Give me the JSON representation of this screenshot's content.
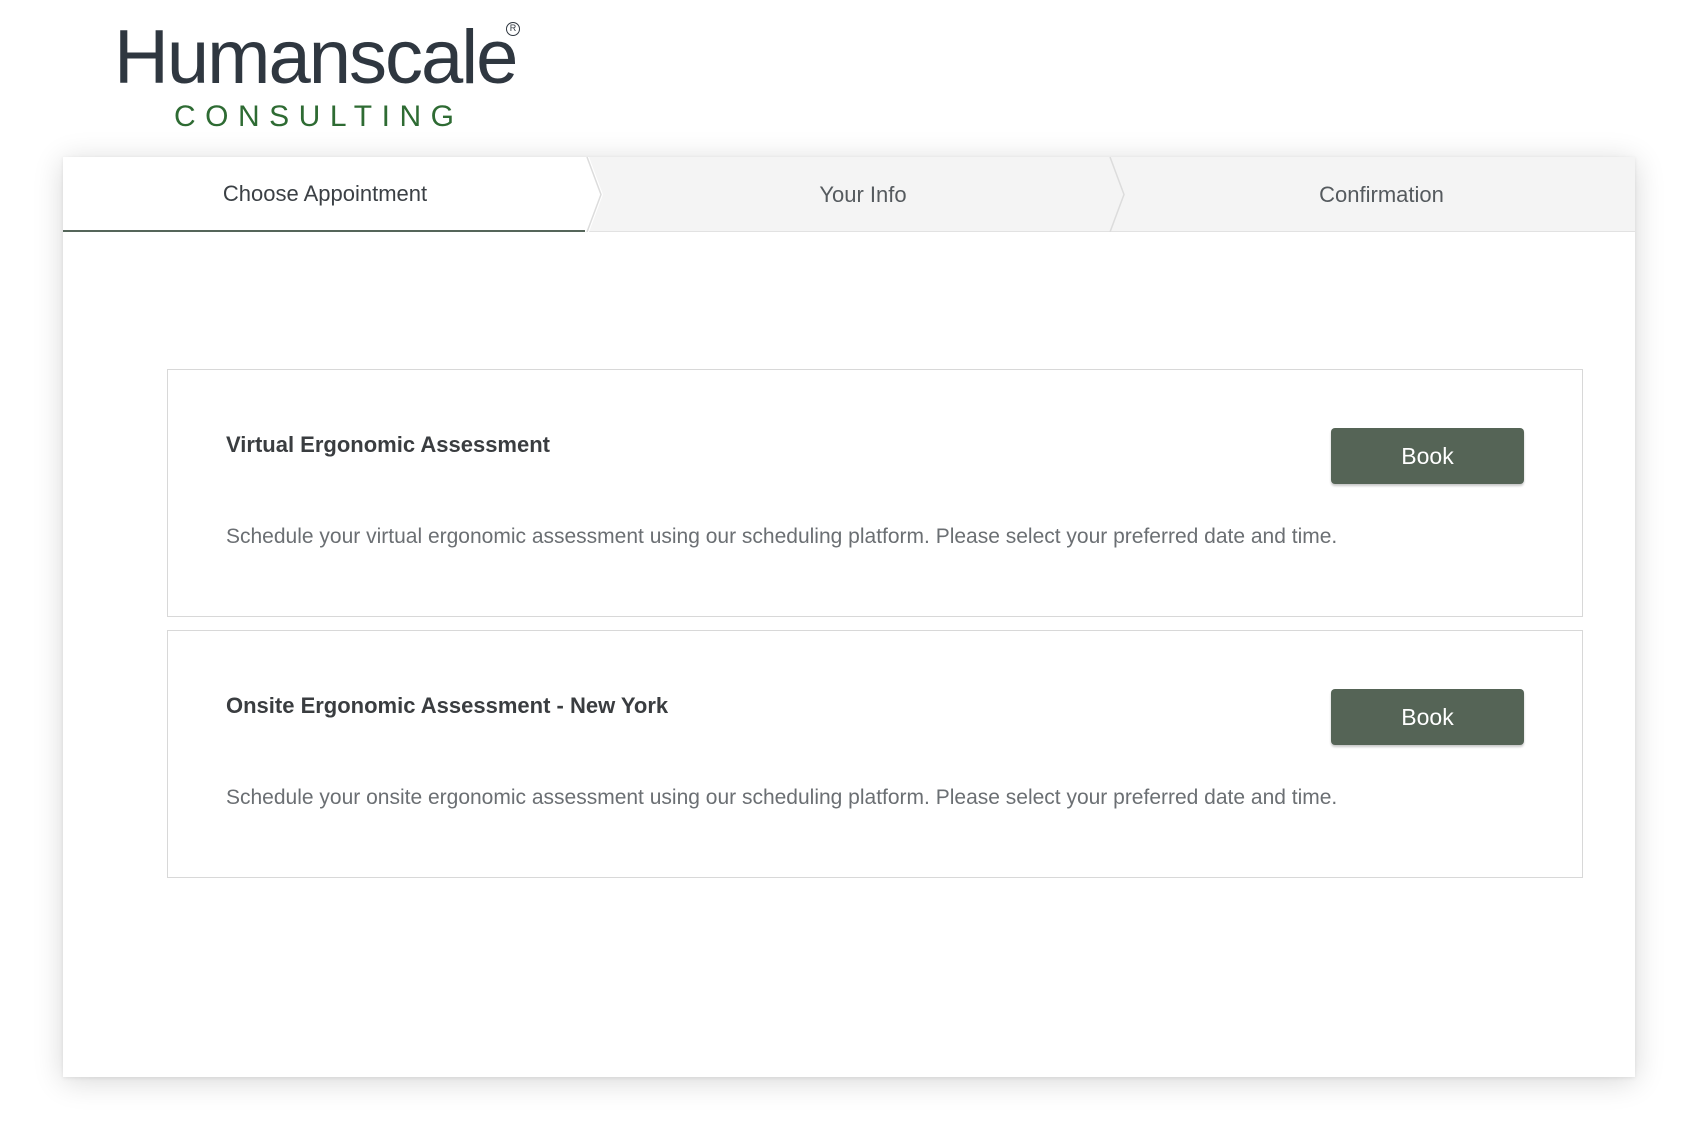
{
  "brand": {
    "name": "Humanscale",
    "registered_mark": "R",
    "subtitle": "CONSULTING",
    "colors": {
      "logo_text": "#2f3740",
      "logo_subtitle": "#2e6b33",
      "button": "#556456"
    }
  },
  "stepper": {
    "steps": [
      {
        "label": "Choose Appointment",
        "active": true
      },
      {
        "label": "Your Info",
        "active": false
      },
      {
        "label": "Confirmation",
        "active": false
      }
    ]
  },
  "appointments": [
    {
      "title": "Virtual Ergonomic Assessment",
      "description": "Schedule your virtual ergonomic assessment using our scheduling platform. Please select your preferred date and time.",
      "button_label": "Book"
    },
    {
      "title": "Onsite Ergonomic Assessment - New York",
      "description": "Schedule your onsite ergonomic assessment using our scheduling platform. Please select your preferred date and time.",
      "button_label": "Book"
    }
  ]
}
